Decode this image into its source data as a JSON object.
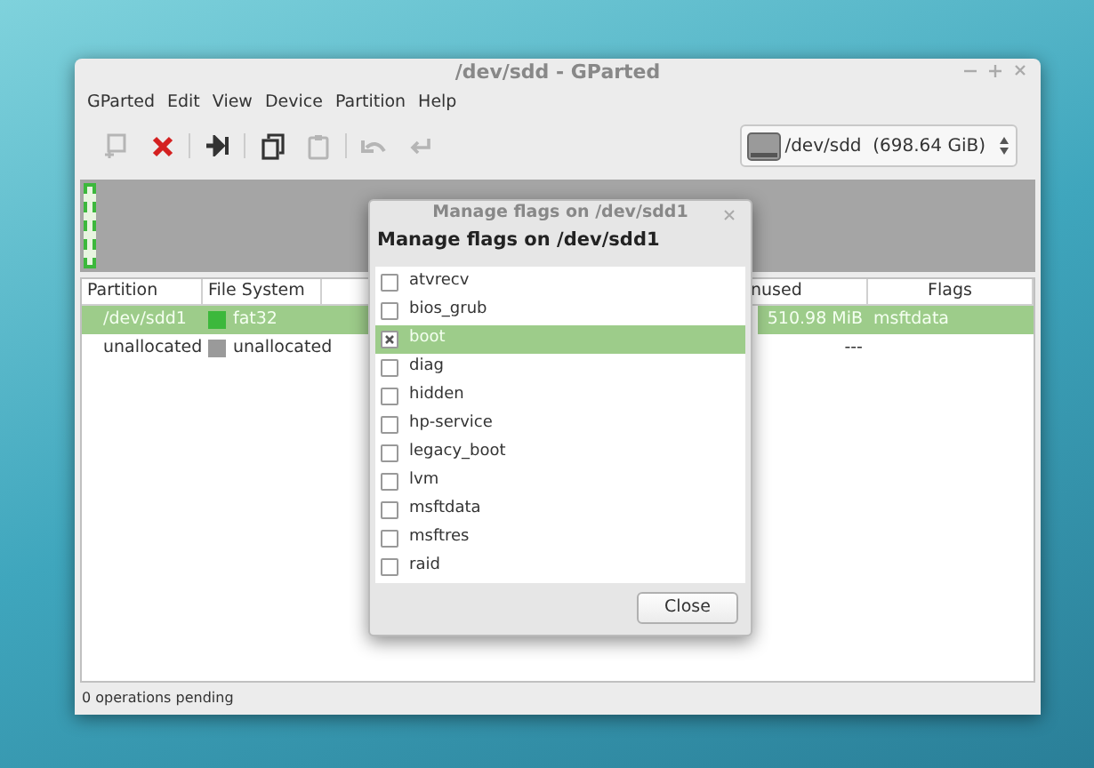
{
  "window": {
    "title": "/dev/sdd - GParted"
  },
  "menu": [
    "GParted",
    "Edit",
    "View",
    "Device",
    "Partition",
    "Help"
  ],
  "toolbar": [
    {
      "kind": "new",
      "disabled": true
    },
    {
      "kind": "delete",
      "disabled": false
    },
    {
      "kind": "resize",
      "disabled": false
    },
    {
      "kind": "copy",
      "disabled": false
    },
    {
      "kind": "paste",
      "disabled": true
    },
    {
      "kind": "undo",
      "disabled": true
    },
    {
      "kind": "apply",
      "disabled": true
    }
  ],
  "device_selector": {
    "value": "/dev/sdd  (698.64 GiB)"
  },
  "table": {
    "columns": [
      "Partition",
      "File System",
      "",
      "",
      "nused",
      "Flags"
    ],
    "rows": [
      {
        "partition": "/dev/sdd1",
        "color": "#3cb83c",
        "file_system": "fat32",
        "unused": "510.98 MiB",
        "flags": "msftdata",
        "selected": true
      },
      {
        "partition": "unallocated",
        "color": "#9a9a9a",
        "file_system": "unallocated",
        "unused": "---",
        "flags": "",
        "selected": false
      }
    ]
  },
  "status_bar": "0 operations pending",
  "dialog": {
    "title": "Manage flags on /dev/sdd1",
    "heading": "Manage flags on /dev/sdd1",
    "flags": [
      {
        "label": "atvrecv",
        "checked": false,
        "selected": false
      },
      {
        "label": "bios_grub",
        "checked": false,
        "selected": false
      },
      {
        "label": "boot",
        "checked": true,
        "selected": true
      },
      {
        "label": "diag",
        "checked": false,
        "selected": false
      },
      {
        "label": "hidden",
        "checked": false,
        "selected": false
      },
      {
        "label": "hp-service",
        "checked": false,
        "selected": false
      },
      {
        "label": "legacy_boot",
        "checked": false,
        "selected": false
      },
      {
        "label": "lvm",
        "checked": false,
        "selected": false
      },
      {
        "label": "msftdata",
        "checked": false,
        "selected": false
      },
      {
        "label": "msftres",
        "checked": false,
        "selected": false
      },
      {
        "label": "raid",
        "checked": false,
        "selected": false
      }
    ],
    "button": "Close"
  }
}
